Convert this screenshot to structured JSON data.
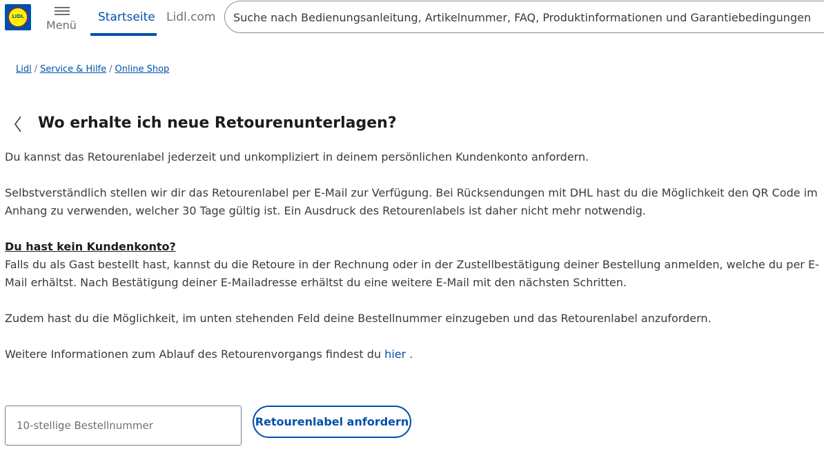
{
  "header": {
    "logo_text": "LIDL",
    "menu_label": "Menü",
    "nav": [
      {
        "label": "Startseite"
      },
      {
        "label": "Lidl.com"
      }
    ],
    "search_text": "Suche nach Bedienungsanleitung, Artikelnummer, FAQ, Produktinformationen und Garantiebedingungen"
  },
  "breadcrumb": [
    {
      "label": "Lidl"
    },
    {
      "label": "Service & Hilfe"
    },
    {
      "label": "Online Shop"
    }
  ],
  "page_title": "Wo erhalte ich neue Retourenunterlagen?",
  "content": {
    "p1": "Du kannst das Retourenlabel jederzeit und unkompliziert in deinem persönlichen Kundenkonto anfordern.",
    "p2": "Selbstverständlich stellen wir dir das Retourenlabel per E-Mail zur Verfügung. Bei Rücksendungen mit DHL hast du die Möglichkeit den QR Code im Anhang zu verwenden, welcher 30 Tage gültig ist. Ein Ausdruck des Retourenlabels ist daher nicht mehr notwendig.",
    "q_heading": "Du hast kein Kundenkonto?",
    "p3": "Falls du als Gast bestellt hast, kannst du die Retoure in der Rechnung oder in der Zustellbestätigung deiner Bestellung anmelden, welche du per E-Mail erhältst. Nach Bestätigung deiner E-Mailadresse erhältst du eine weitere E-Mail mit den nächsten Schritten.",
    "p4": "Zudem hast du die Möglichkeit, im unten stehenden Feld deine Bestellnummer einzugeben und das Retourenlabel anzufordern.",
    "p5_text": "Weitere Informationen zum Ablauf des Retourenvorgangs findest du",
    "p5_link": "hier",
    "p5_end": "."
  },
  "form": {
    "order_placeholder": "10-stellige Bestellnummer",
    "submit_label": "Retourenlabel anfordern"
  },
  "colors": {
    "brand_blue": "#0050aa",
    "brand_yellow": "#fff000",
    "brand_red": "#e60a14"
  }
}
